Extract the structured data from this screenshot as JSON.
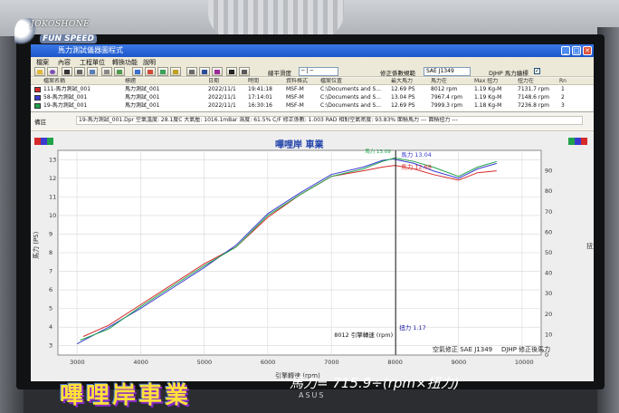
{
  "overlay": {
    "logo_line1": "JOKOSHONE",
    "logo_line2": "FUN SPEED",
    "sign_text": "嗶哩岸車業",
    "formula_text": "馬力= 715.9÷(rpm×扭力)",
    "monitor_brand": "ASUS"
  },
  "window": {
    "title": "馬力測試儀器圖程式",
    "btn_min": "_",
    "btn_max": "□",
    "btn_close": "✕"
  },
  "menu": [
    "檔案",
    "內容",
    "工程單位",
    "轉換功能",
    "說明"
  ],
  "toolbar": {
    "smooth_label": "線平滑度",
    "smooth_value": "─ | ─",
    "correction_label": "修正係數規範",
    "correction_value": "SAE J1349",
    "dhp_label": "DJHP 馬力繪標",
    "dhp_checked": "✓"
  },
  "runs": {
    "headers": [
      "檔案名稱",
      "標題",
      "日期",
      "時間",
      "資料格式",
      "檔案位置",
      "最大馬力",
      "馬力在",
      "Max 扭力",
      "扭力在",
      "Rn"
    ],
    "rows": [
      {
        "name": "111-馬力測試_001",
        "title": "馬力測試_001",
        "date": "2022/11/1",
        "time": "19:41:18",
        "format": "MSF-M",
        "path": "C:\\Documents and S...",
        "max_hp": "12.69 PS",
        "hp_at": "8012 rpm",
        "max_tq": "1.19 Kg-M",
        "tq_at": "7131.7 rpm",
        "n": "1",
        "color": "#d62a2a"
      },
      {
        "name": "58-馬力測試_001",
        "title": "馬力測試_001",
        "date": "2022/11/1",
        "time": "17:14:01",
        "format": "MSF-M",
        "path": "C:\\Documents and S...",
        "max_hp": "13.04 PS",
        "hp_at": "7967.4 rpm",
        "max_tq": "1.19 Kg-M",
        "tq_at": "7148.6 rpm",
        "n": "2",
        "color": "#3a3ad0"
      },
      {
        "name": "19-馬力測試_001",
        "title": "馬力測試_001",
        "date": "2022/11/1",
        "time": "16:30:16",
        "format": "MSF-M",
        "path": "C:\\Documents and S...",
        "max_hp": "12.69 PS",
        "hp_at": "7999.3 rpm",
        "max_tq": "1.18 Kg-M",
        "tq_at": "7236.8 rpm",
        "n": "3",
        "color": "#1fa34a"
      }
    ]
  },
  "notes": {
    "label": "備註",
    "text": "19-馬力測試_001.Dpr  空氣溫度: 28.1度C  大氣壓: 1016.1mBar  濕度: 61.5%  C/F 修正係數: 1.003  RAD 相對空氣密度: 93.83%  面積馬力 ---  面積扭力 ---"
  },
  "chart_data": {
    "type": "line",
    "title": "嗶哩岸 車業",
    "xlabel": "引擎轉速 (rpm)",
    "ylabel": "馬力 (PS)",
    "ylabel_right": "扭力",
    "xlim": [
      2700,
      10300
    ],
    "ylim": [
      2.5,
      13.5
    ],
    "ylim_right": [
      0,
      100
    ],
    "x_ticks": [
      3000,
      4000,
      5000,
      6000,
      7000,
      8000,
      9000,
      10000
    ],
    "y_ticks": [
      3,
      4,
      5,
      6,
      7,
      8,
      9,
      10,
      11,
      12,
      13
    ],
    "y_ticks_right": [
      0,
      10,
      20,
      30,
      40,
      50,
      60,
      70,
      80,
      90
    ],
    "grid": true,
    "cursor": {
      "rpm": 8012,
      "readout_rpm": "8012 引擎轉速  (rpm)",
      "readout_torque": "扭力 1.17",
      "hp_labels": [
        "馬力 13.04",
        "馬力 12.69"
      ],
      "top_label": "馬力 13.09"
    },
    "footer_left": "空氣修正 SAE J1349",
    "footer_right": "DJHP 修正後馬力",
    "series": [
      {
        "color": "#d62a2a",
        "x": [
          3100,
          3500,
          4000,
          4500,
          5000,
          5500,
          6000,
          6500,
          7000,
          7500,
          7800,
          8000,
          8300,
          8600,
          9000,
          9300,
          9600
        ],
        "y": [
          3.5,
          4.1,
          5.2,
          6.3,
          7.4,
          8.3,
          9.9,
          11.1,
          12.1,
          12.4,
          12.6,
          12.69,
          12.5,
          12.2,
          11.9,
          12.3,
          12.4
        ]
      },
      {
        "color": "#3a3ad0",
        "x": [
          3000,
          3500,
          4000,
          4500,
          5000,
          5500,
          6000,
          6500,
          7000,
          7500,
          7800,
          7967,
          8300,
          8600,
          9000,
          9300,
          9600
        ],
        "y": [
          3.1,
          4.0,
          5.0,
          6.1,
          7.2,
          8.4,
          10.1,
          11.2,
          12.2,
          12.6,
          12.95,
          13.04,
          12.8,
          12.4,
          12.0,
          12.5,
          12.8
        ]
      },
      {
        "color": "#1fa34a",
        "x": [
          3050,
          3500,
          4000,
          4500,
          5000,
          5500,
          6000,
          6500,
          7000,
          7500,
          7800,
          7999,
          8300,
          8600,
          9000,
          9300,
          9600
        ],
        "y": [
          3.3,
          3.9,
          5.1,
          6.2,
          7.3,
          8.3,
          10.0,
          11.1,
          12.1,
          12.5,
          12.9,
          13.09,
          12.9,
          12.6,
          12.1,
          12.6,
          12.9
        ]
      }
    ]
  }
}
